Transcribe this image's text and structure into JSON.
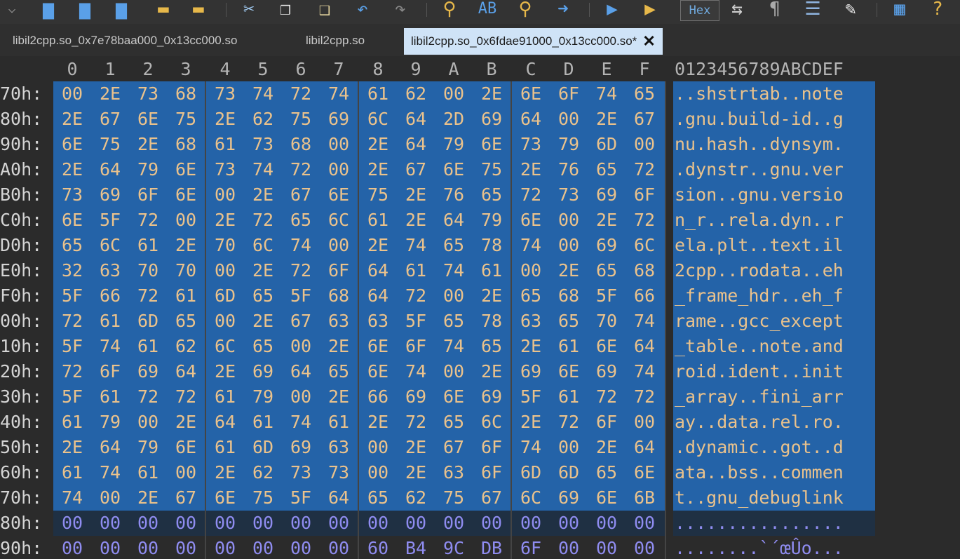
{
  "toolbar": {
    "icons": [
      "open-menu-icon",
      "save-icon",
      "save-as-icon",
      "save-all-icon",
      "open-folder-icon",
      "open-files-icon",
      "cut-icon",
      "copy-icon",
      "paste-icon",
      "undo-icon",
      "redo-icon",
      "find-icon",
      "replace-icon",
      "find-next-icon",
      "goto-icon",
      "macro-play-icon",
      "macro-run-icon",
      "hex-mode-label",
      "compare-icon",
      "paragraph-icon",
      "column-icon",
      "highlight-icon",
      "calculator-icon",
      "help-icon"
    ],
    "hex_label": "Hex"
  },
  "tabs": [
    {
      "label": "libil2cpp.so_0x7e78baa000_0x13cc000.so",
      "active": false
    },
    {
      "label": "libil2cpp.so",
      "active": false
    },
    {
      "label": "libil2cpp.so_0x6fdae91000_0x13cc000.so*",
      "active": true
    }
  ],
  "columns": [
    "0",
    "1",
    "2",
    "3",
    "4",
    "5",
    "6",
    "7",
    "8",
    "9",
    "A",
    "B",
    "C",
    "D",
    "E",
    "F"
  ],
  "ascii_header": "0123456789ABCDEF",
  "rows": [
    {
      "offset": "70h:",
      "bytes": [
        "00",
        "2E",
        "73",
        "68",
        "73",
        "74",
        "72",
        "74",
        "61",
        "62",
        "00",
        "2E",
        "6E",
        "6F",
        "74",
        "65"
      ],
      "ascii": "..shstrtab..note",
      "selected": true
    },
    {
      "offset": "80h:",
      "bytes": [
        "2E",
        "67",
        "6E",
        "75",
        "2E",
        "62",
        "75",
        "69",
        "6C",
        "64",
        "2D",
        "69",
        "64",
        "00",
        "2E",
        "67"
      ],
      "ascii": ".gnu.build-id..g",
      "selected": true
    },
    {
      "offset": "90h:",
      "bytes": [
        "6E",
        "75",
        "2E",
        "68",
        "61",
        "73",
        "68",
        "00",
        "2E",
        "64",
        "79",
        "6E",
        "73",
        "79",
        "6D",
        "00"
      ],
      "ascii": "nu.hash..dynsym.",
      "selected": true
    },
    {
      "offset": "A0h:",
      "bytes": [
        "2E",
        "64",
        "79",
        "6E",
        "73",
        "74",
        "72",
        "00",
        "2E",
        "67",
        "6E",
        "75",
        "2E",
        "76",
        "65",
        "72"
      ],
      "ascii": ".dynstr..gnu.ver",
      "selected": true
    },
    {
      "offset": "B0h:",
      "bytes": [
        "73",
        "69",
        "6F",
        "6E",
        "00",
        "2E",
        "67",
        "6E",
        "75",
        "2E",
        "76",
        "65",
        "72",
        "73",
        "69",
        "6F"
      ],
      "ascii": "sion..gnu.versio",
      "selected": true
    },
    {
      "offset": "C0h:",
      "bytes": [
        "6E",
        "5F",
        "72",
        "00",
        "2E",
        "72",
        "65",
        "6C",
        "61",
        "2E",
        "64",
        "79",
        "6E",
        "00",
        "2E",
        "72"
      ],
      "ascii": "n_r..rela.dyn..r",
      "selected": true
    },
    {
      "offset": "D0h:",
      "bytes": [
        "65",
        "6C",
        "61",
        "2E",
        "70",
        "6C",
        "74",
        "00",
        "2E",
        "74",
        "65",
        "78",
        "74",
        "00",
        "69",
        "6C"
      ],
      "ascii": "ela.plt..text.il",
      "selected": true
    },
    {
      "offset": "E0h:",
      "bytes": [
        "32",
        "63",
        "70",
        "70",
        "00",
        "2E",
        "72",
        "6F",
        "64",
        "61",
        "74",
        "61",
        "00",
        "2E",
        "65",
        "68"
      ],
      "ascii": "2cpp..rodata..eh",
      "selected": true
    },
    {
      "offset": "F0h:",
      "bytes": [
        "5F",
        "66",
        "72",
        "61",
        "6D",
        "65",
        "5F",
        "68",
        "64",
        "72",
        "00",
        "2E",
        "65",
        "68",
        "5F",
        "66"
      ],
      "ascii": "_frame_hdr..eh_f",
      "selected": true
    },
    {
      "offset": "00h:",
      "bytes": [
        "72",
        "61",
        "6D",
        "65",
        "00",
        "2E",
        "67",
        "63",
        "63",
        "5F",
        "65",
        "78",
        "63",
        "65",
        "70",
        "74"
      ],
      "ascii": "rame..gcc_except",
      "selected": true
    },
    {
      "offset": "10h:",
      "bytes": [
        "5F",
        "74",
        "61",
        "62",
        "6C",
        "65",
        "00",
        "2E",
        "6E",
        "6F",
        "74",
        "65",
        "2E",
        "61",
        "6E",
        "64"
      ],
      "ascii": "_table..note.and",
      "selected": true
    },
    {
      "offset": "20h:",
      "bytes": [
        "72",
        "6F",
        "69",
        "64",
        "2E",
        "69",
        "64",
        "65",
        "6E",
        "74",
        "00",
        "2E",
        "69",
        "6E",
        "69",
        "74"
      ],
      "ascii": "roid.ident..init",
      "selected": true
    },
    {
      "offset": "30h:",
      "bytes": [
        "5F",
        "61",
        "72",
        "72",
        "61",
        "79",
        "00",
        "2E",
        "66",
        "69",
        "6E",
        "69",
        "5F",
        "61",
        "72",
        "72"
      ],
      "ascii": "_array..fini_arr",
      "selected": true
    },
    {
      "offset": "40h:",
      "bytes": [
        "61",
        "79",
        "00",
        "2E",
        "64",
        "61",
        "74",
        "61",
        "2E",
        "72",
        "65",
        "6C",
        "2E",
        "72",
        "6F",
        "00"
      ],
      "ascii": "ay..data.rel.ro.",
      "selected": true
    },
    {
      "offset": "50h:",
      "bytes": [
        "2E",
        "64",
        "79",
        "6E",
        "61",
        "6D",
        "69",
        "63",
        "00",
        "2E",
        "67",
        "6F",
        "74",
        "00",
        "2E",
        "64"
      ],
      "ascii": ".dynamic..got..d",
      "selected": true
    },
    {
      "offset": "60h:",
      "bytes": [
        "61",
        "74",
        "61",
        "00",
        "2E",
        "62",
        "73",
        "73",
        "00",
        "2E",
        "63",
        "6F",
        "6D",
        "6D",
        "65",
        "6E"
      ],
      "ascii": "ata..bss..commen",
      "selected": true
    },
    {
      "offset": "70h:",
      "bytes": [
        "74",
        "00",
        "2E",
        "67",
        "6E",
        "75",
        "5F",
        "64",
        "65",
        "62",
        "75",
        "67",
        "6C",
        "69",
        "6E",
        "6B"
      ],
      "ascii": "t..gnu_debuglink",
      "selected": true
    },
    {
      "offset": "80h:",
      "bytes": [
        "00",
        "00",
        "00",
        "00",
        "00",
        "00",
        "00",
        "00",
        "00",
        "00",
        "00",
        "00",
        "00",
        "00",
        "00",
        "00"
      ],
      "ascii": "................",
      "selected": false
    },
    {
      "offset": "90h:",
      "bytes": [
        "00",
        "00",
        "00",
        "00",
        "00",
        "00",
        "00",
        "00",
        "60",
        "B4",
        "9C",
        "DB",
        "6F",
        "00",
        "00",
        "00"
      ],
      "ascii": "........`´œÛo...",
      "selected": false
    }
  ],
  "colors": {
    "selection": "#2463a8",
    "selected_text": "#eac28c",
    "unselected_text": "#8f8cf0",
    "tab_active": "#cfe3f7"
  }
}
